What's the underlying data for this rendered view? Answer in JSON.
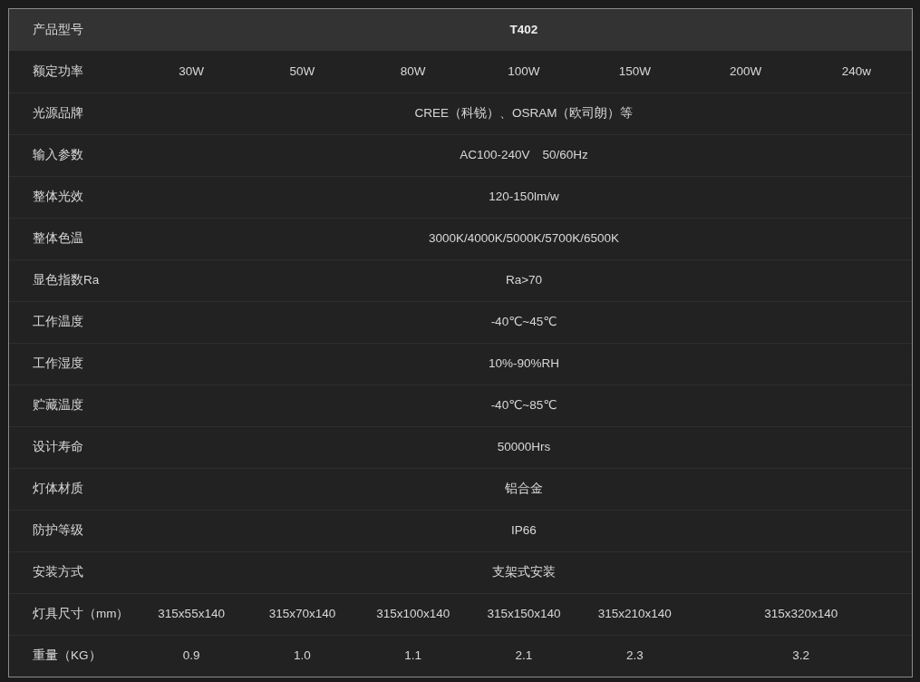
{
  "rows": [
    {
      "kind": "header",
      "label": "产品型号",
      "cells": [
        "T402"
      ]
    },
    {
      "kind": "body",
      "label": "额定功率",
      "cells": [
        "30W",
        "50W",
        "80W",
        "100W",
        "150W",
        "200W",
        "240w"
      ]
    },
    {
      "kind": "body",
      "label": "光源品牌",
      "cells": [
        "CREE（科锐）、OSRAM（欧司朗）等"
      ]
    },
    {
      "kind": "body",
      "label": "输入参数",
      "cells": [
        "AC100-240V　50/60Hz"
      ]
    },
    {
      "kind": "body",
      "label": "整体光效",
      "cells": [
        "120-150lm/w"
      ]
    },
    {
      "kind": "body",
      "label": "整体色温",
      "cells": [
        "3000K/4000K/5000K/5700K/6500K"
      ]
    },
    {
      "kind": "body",
      "label": "显色指数Ra",
      "cells": [
        "Ra>70"
      ]
    },
    {
      "kind": "body",
      "label": "工作温度",
      "cells": [
        "-40℃~45℃"
      ]
    },
    {
      "kind": "body",
      "label": "工作湿度",
      "cells": [
        "10%-90%RH"
      ]
    },
    {
      "kind": "body",
      "label": "贮藏温度",
      "cells": [
        "-40℃~85℃"
      ]
    },
    {
      "kind": "body",
      "label": "设计寿命",
      "cells": [
        "50000Hrs"
      ]
    },
    {
      "kind": "body",
      "label": "灯体材质",
      "cells": [
        "铝合金"
      ]
    },
    {
      "kind": "body",
      "label": "防护等级",
      "cells": [
        "IP66"
      ]
    },
    {
      "kind": "body",
      "label": "安装方式",
      "cells": [
        "支架式安装"
      ]
    },
    {
      "kind": "body",
      "label": "灯具尺寸（mm）",
      "cells": [
        "315x55x140",
        "315x70x140",
        "315x100x140",
        "315x150x140",
        "315x210x140",
        "315x320x140"
      ]
    },
    {
      "kind": "body",
      "label": "重量（KG）",
      "cells": [
        "0.9",
        "1.0",
        "1.1",
        "2.1",
        "2.3",
        "3.2"
      ]
    }
  ]
}
